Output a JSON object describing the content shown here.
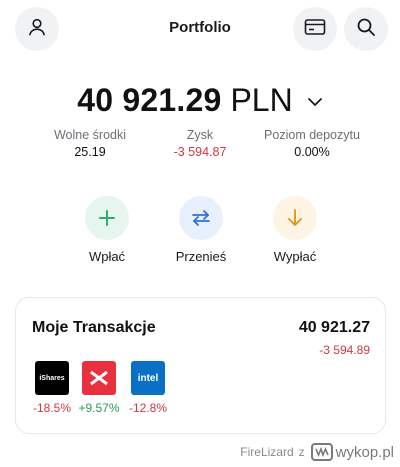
{
  "header": {
    "title": "Portfolio",
    "left_icon": "user-icon",
    "right_icons": [
      "card-icon",
      "search-icon"
    ]
  },
  "balance": {
    "amount": "40 921.29",
    "currency": "PLN"
  },
  "stats": [
    {
      "label": "Wolne środki",
      "value": "25.19",
      "status": "neutral"
    },
    {
      "label": "Zysk",
      "value": "-3 594.87",
      "status": "negative"
    },
    {
      "label": "Poziom depozytu",
      "value": "0.00%",
      "status": "neutral"
    }
  ],
  "actions": [
    {
      "label": "Wpłać",
      "icon": "plus-icon",
      "color": "#2bae6b",
      "bg": "#e6f6ee"
    },
    {
      "label": "Przenieś",
      "icon": "transfer-arrows-icon",
      "color": "#2f6fe0",
      "bg": "#e8f0fd"
    },
    {
      "label": "Wypłać",
      "icon": "arrow-down-icon",
      "color": "#e09a1a",
      "bg": "#fdf4e3"
    }
  ],
  "transactions": {
    "title": "Moje Transakcje",
    "total": "40 921.27",
    "change": "-3 594.89",
    "assets": [
      {
        "logo_text": "iShares",
        "icon": "ishares-logo",
        "change": "-18.5%",
        "status": "negative"
      },
      {
        "logo_text": "",
        "icon": "xtb-logo",
        "change": "+9.57%",
        "status": "positive"
      },
      {
        "logo_text": "intel",
        "icon": "intel-logo",
        "change": "-12.8%",
        "status": "negative"
      }
    ]
  },
  "watermark": {
    "user": "FireLizard",
    "separator": "z",
    "site": "wykop.pl"
  },
  "colors": {
    "negative": "#d0393f",
    "positive": "#2b9a5a",
    "icon_bg": "#f1f2f4"
  }
}
